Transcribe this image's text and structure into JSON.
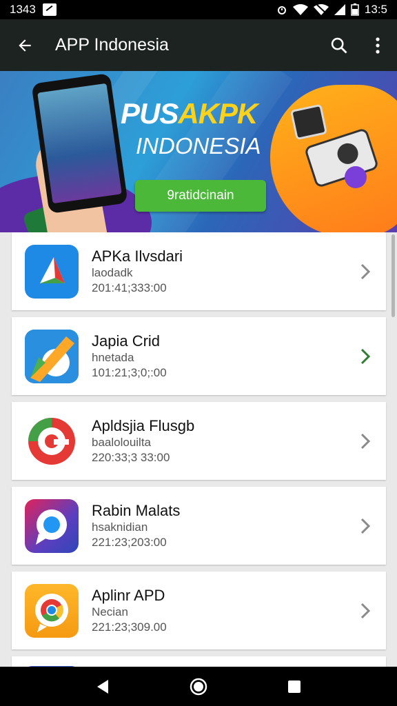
{
  "status_bar": {
    "time_left": "1343",
    "time_right": "13:5"
  },
  "app_bar": {
    "title": "APP Indonesia",
    "back_icon": "arrow-back-icon",
    "search_icon": "search-icon",
    "more_icon": "more-vert-icon"
  },
  "banner": {
    "brand_white": "PUS",
    "brand_yellow": "AKPK",
    "subtitle": "INDONESIA",
    "button_label": "9ratidcinain"
  },
  "apps": [
    {
      "name": "APKa Ilvsdari",
      "desc": "laodadk",
      "date": "201:41;333:00",
      "icon": "play-triangle-icon",
      "chevron_color": "#8a8a8a"
    },
    {
      "name": "Japia Crid",
      "desc": "hnetada",
      "date": "101:21;3;0;:00",
      "icon": "pencil-icon",
      "chevron_color": "#2e7d32"
    },
    {
      "name": "Apldsjia Flusgb",
      "desc": "baalolouilta",
      "date": "220:33;3 33:00",
      "icon": "gear-g-icon",
      "chevron_color": "#8a8a8a"
    },
    {
      "name": "Rabin Malats",
      "desc": "hsaknidian",
      "date": "221:23;203:00",
      "icon": "chat-bubble-icon",
      "chevron_color": "#8a8a8a"
    },
    {
      "name": "Aplinr APD",
      "desc": "Necian",
      "date": "221:23;309.00",
      "icon": "chrome-icon",
      "chevron_color": "#8a8a8a"
    }
  ],
  "nav": {
    "back_icon": "nav-back-icon",
    "home_icon": "nav-home-icon",
    "recents_icon": "nav-recents-icon"
  }
}
